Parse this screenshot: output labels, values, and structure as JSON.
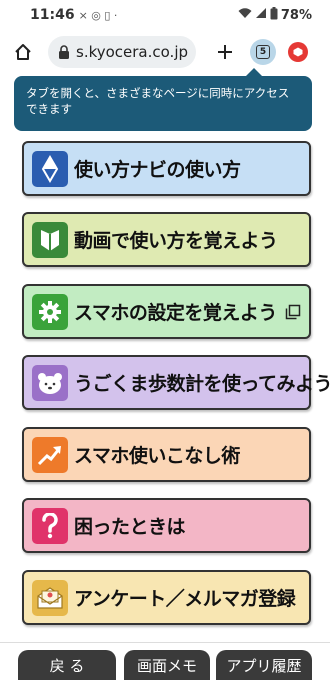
{
  "status_bar": {
    "time": "11:46",
    "left_icons": "× ◎ ▯ ·",
    "battery": "78%"
  },
  "browser": {
    "url": "s.kyocera.co.jp",
    "tab_count": "5"
  },
  "tooltip": {
    "text": "タブを開くと、さまざまなページに同時にアクセスできます"
  },
  "menu": [
    {
      "label": "使い方ナビの使い方",
      "icon": "compass-icon",
      "bg": "#c6dff5",
      "icon_bg": "#2a5db0"
    },
    {
      "label": "動画で使い方を覚えよう",
      "icon": "shield-leaf-icon",
      "bg": "#dfeab2",
      "icon_bg": "#3a8a3a"
    },
    {
      "label": "スマホの設定を覚えよう",
      "icon": "gear-icon",
      "bg": "#c2ecc2",
      "icon_bg": "#3aa33a"
    },
    {
      "label": "うごくま歩数計を使ってみよう",
      "icon": "bear-icon",
      "bg": "#d3c2ec",
      "icon_bg": "#9a70c8"
    },
    {
      "label": "スマホ使いこなし術",
      "icon": "trend-up-icon",
      "bg": "#fbd6b6",
      "icon_bg": "#ee7a2a"
    },
    {
      "label": "困ったときは",
      "icon": "question-icon",
      "bg": "#f3b6c6",
      "icon_bg": "#e0336a"
    },
    {
      "label": "アンケート／メルマガ登録",
      "icon": "mail-icon",
      "bg": "#f8e6b2",
      "icon_bg": "#e6b84a"
    }
  ],
  "bottom_nav": {
    "back": "戻 る",
    "memo": "画面メモ",
    "history": "アプリ履歴"
  }
}
